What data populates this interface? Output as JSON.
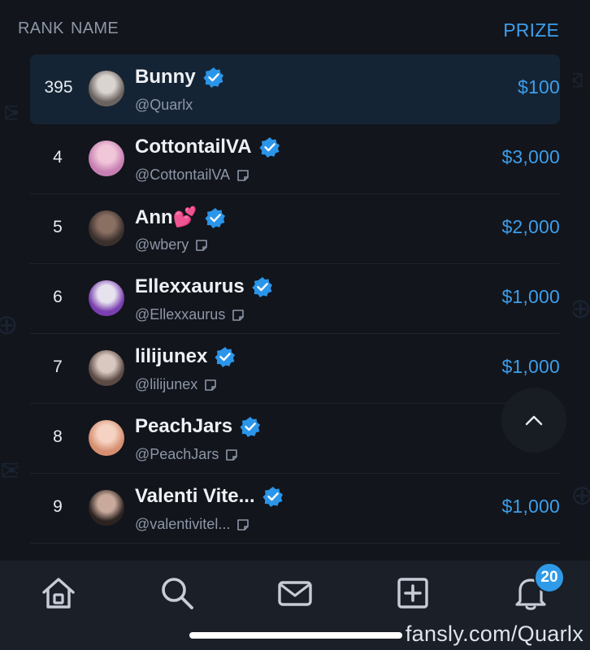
{
  "header": {
    "rank_label": "RANK",
    "name_label": "NAME",
    "prize_label": "PRIZE"
  },
  "rows": [
    {
      "rank": "395",
      "name": "Bunny",
      "handle": "@Quarlx",
      "prize": "$100",
      "verified": true,
      "note_icon": false,
      "highlight": true,
      "avatar_colors": [
        "#6b6360",
        "#d9d4d0"
      ]
    },
    {
      "rank": "4",
      "name": "CottontailVA",
      "handle": "@CottontailVA",
      "prize": "$3,000",
      "verified": true,
      "note_icon": true,
      "highlight": false,
      "avatar_colors": [
        "#c77fb3",
        "#f1c6d8"
      ]
    },
    {
      "rank": "5",
      "name": "Ann💕",
      "handle": "@wbery",
      "prize": "$2,000",
      "verified": true,
      "note_icon": true,
      "highlight": false,
      "avatar_colors": [
        "#3a302c",
        "#8a6f63"
      ]
    },
    {
      "rank": "6",
      "name": "Ellexxaurus",
      "handle": "@Ellexxaurus",
      "prize": "$1,000",
      "verified": true,
      "note_icon": true,
      "highlight": false,
      "avatar_colors": [
        "#7a3fb0",
        "#e7e3ee"
      ]
    },
    {
      "rank": "7",
      "name": "lilijunex",
      "handle": "@lilijunex",
      "prize": "$1,000",
      "verified": true,
      "note_icon": true,
      "highlight": false,
      "avatar_colors": [
        "#5c4a45",
        "#d9c8bf"
      ]
    },
    {
      "rank": "8",
      "name": "PeachJars",
      "handle": "@PeachJars",
      "prize": "$",
      "verified": true,
      "note_icon": true,
      "highlight": false,
      "avatar_colors": [
        "#d68f70",
        "#f5d2c2"
      ]
    },
    {
      "rank": "9",
      "name": "Valenti Vite...",
      "handle": "@valentivitel...",
      "prize": "$1,000",
      "verified": true,
      "note_icon": true,
      "highlight": false,
      "avatar_colors": [
        "#2c2321",
        "#c9a99b"
      ]
    }
  ],
  "nav": {
    "icons": [
      "home-icon",
      "search-icon",
      "mail-icon",
      "add-post-icon",
      "bell-icon"
    ],
    "notification_count": "20"
  },
  "watermark": "fansly.com/Quarlx",
  "colors": {
    "accent": "#3d9eeb",
    "badge": "#2f9ae8",
    "verified": "#2b95e9",
    "highlight_row": "#152434"
  }
}
